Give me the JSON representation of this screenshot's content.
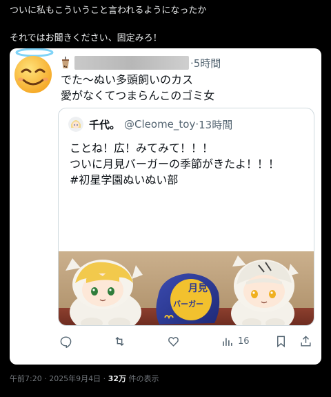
{
  "post": {
    "lines": [
      "ついに私もこういうこと言われるようになったか",
      "それではお聞きください、固定みろ！"
    ]
  },
  "reply": {
    "time": "·5時間",
    "lines": [
      "でた〜ぬい多頭飼いのカス",
      "愛がなくてつまらんこのゴミ女"
    ]
  },
  "quote": {
    "name": "千代。",
    "handle": "@Cleome_toy",
    "dot": "·",
    "time": "13時間",
    "lines": [
      "ことね！広！みてみて！！！",
      "ついに月見バーガーの季節がきたよ！！！",
      "#初星学園ぬいぬい部"
    ],
    "bag_text": [
      "月見",
      "バーガー"
    ]
  },
  "actions": {
    "reply_icon": "reply-icon",
    "retweet_icon": "retweet-icon",
    "like_icon": "like-icon",
    "views_icon": "views-icon",
    "views_count": "16",
    "bookmark_icon": "bookmark-icon",
    "share_icon": "share-icon"
  },
  "meta": {
    "timestamp": "午前7:20 · 2025年9月4日 · ",
    "views": "32万",
    "views_suffix": " 件の表示"
  },
  "colors": {
    "background": "#000000",
    "card": "#ffffff",
    "text_dark": "#0f1419",
    "text_muted": "#536471",
    "bag_blue": "#2f3a8f",
    "bag_yellow": "#f2c12e"
  }
}
